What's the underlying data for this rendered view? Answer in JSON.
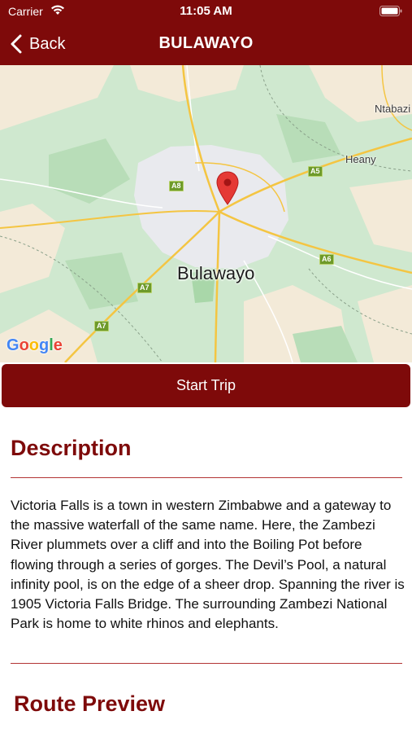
{
  "status_bar": {
    "carrier": "Carrier",
    "time": "11:05 AM"
  },
  "nav": {
    "back_label": "Back",
    "title": "BULAWAYO"
  },
  "map": {
    "city_label": "Bulawayo",
    "place_labels": [
      "Ntabazi",
      "Heany"
    ],
    "route_badges": [
      "A8",
      "A5",
      "A6",
      "A7",
      "A7"
    ],
    "provider_logo": "Google"
  },
  "actions": {
    "start_trip_label": "Start Trip"
  },
  "description": {
    "heading": "Description",
    "body": "Victoria Falls is a town in western Zimbabwe and a gateway to the massive waterfall of the same name. Here, the Zambezi River plummets over a cliff and into the Boiling Pot before flowing through a series of gorges. The Devil’s Pool, a natural infinity pool, is on the edge of a sheer drop. Spanning the river is 1905 Victoria Falls Bridge. The surrounding Zambezi National Park is home to white rhinos and elephants."
  },
  "route_preview": {
    "heading": "Route Preview"
  },
  "colors": {
    "brand": "#7e0a0a",
    "divider": "#b33535",
    "map_pin": "#e53935"
  }
}
